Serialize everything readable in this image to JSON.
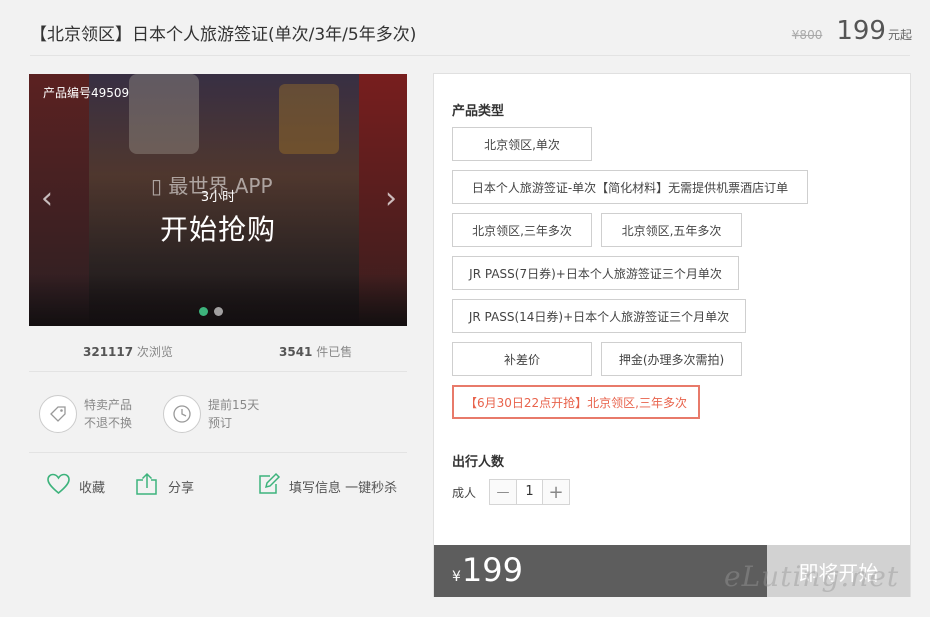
{
  "header": {
    "title": "【北京领区】日本个人旅游签证(单次/3年/5年多次)",
    "original_price": "¥800",
    "price": "199",
    "price_unit": "元起"
  },
  "banner": {
    "product_id": "产品编号49509",
    "watermark": "▯ 最世界 APP",
    "countdown": "3小时",
    "start_label": "开始抢购",
    "prev_icon": "chevron-left-icon",
    "next_icon": "chevron-right-icon",
    "dots": 2
  },
  "stats": {
    "views_num": "321117",
    "views_label": " 次浏览",
    "sold_num": "3541",
    "sold_label": " 件已售"
  },
  "features": [
    {
      "line1": "特卖产品",
      "line2": "不退不换",
      "icon": "tag-icon"
    },
    {
      "line1": "提前15天",
      "line2": "预订",
      "icon": "clock-icon"
    }
  ],
  "actions": {
    "favorite": "收藏",
    "share": "分享",
    "fill_info": "填写信息 一键秒杀"
  },
  "panel": {
    "type_title": "产品类型",
    "options": [
      "北京领区,单次",
      "日本个人旅游签证-单次【简化材料】无需提供机票酒店订单",
      "北京领区,三年多次",
      "北京领区,五年多次",
      "JR PASS(7日券)+日本个人旅游签证三个月单次",
      "JR PASS(14日券)+日本个人旅游签证三个月单次",
      "补差价",
      "押金(办理多次需拍)"
    ],
    "selected_tag": "【6月30日22点开抢】",
    "selected_label": "北京领区,三年多次",
    "travelers_title": "出行人数",
    "adult_label": "成人",
    "minus": "—",
    "qty": "1",
    "plus": "+",
    "currency": "¥",
    "total": "199",
    "buy_label": "即将开始"
  },
  "site_watermark": "eLuting.net",
  "colors": {
    "accent": "#3db37c",
    "highlight": "#e8634c",
    "bar": "#5d5d5d"
  }
}
